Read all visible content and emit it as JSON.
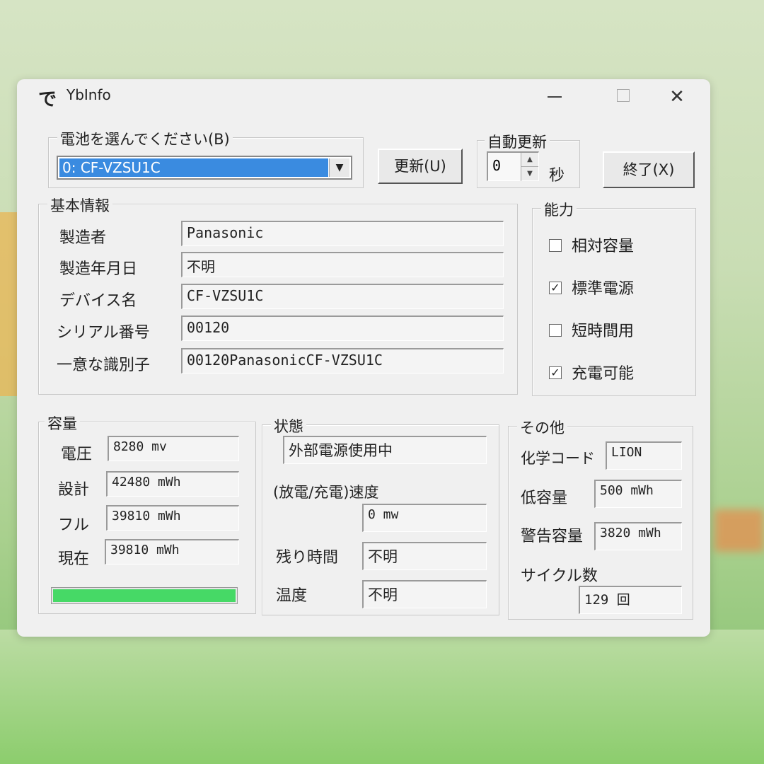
{
  "window": {
    "title": "YbInfo",
    "icon_glyph": "で",
    "close_glyph": "✕"
  },
  "battery_select": {
    "legend": "電池を選んでください(B)",
    "selected": "0: CF-VZSU1C",
    "arrow": "▼"
  },
  "refresh_button": "更新(U)",
  "auto_update": {
    "legend": "自動更新",
    "value": "0",
    "unit": "秒",
    "up": "▲",
    "down": "▼"
  },
  "exit_button": "終了(X)",
  "basic_info": {
    "legend": "基本情報",
    "rows": [
      {
        "label": "製造者",
        "value": "Panasonic"
      },
      {
        "label": "製造年月日",
        "value": "不明"
      },
      {
        "label": "デバイス名",
        "value": "CF-VZSU1C"
      },
      {
        "label": "シリアル番号",
        "value": "00120"
      },
      {
        "label": "一意な識別子",
        "value": "00120PanasonicCF-VZSU1C"
      }
    ]
  },
  "capability": {
    "legend": "能力",
    "items": [
      {
        "label": "相対容量",
        "checked": false,
        "mark": ""
      },
      {
        "label": "標準電源",
        "checked": true,
        "mark": "✓"
      },
      {
        "label": "短時間用",
        "checked": false,
        "mark": ""
      },
      {
        "label": "充電可能",
        "checked": true,
        "mark": "✓"
      }
    ]
  },
  "capacity": {
    "legend": "容量",
    "rows": [
      {
        "label": "電圧",
        "value": "8280 mv"
      },
      {
        "label": "設計",
        "value": "42480 mWh"
      },
      {
        "label": "フル",
        "value": "39810 mWh"
      },
      {
        "label": "現在",
        "value": "39810 mWh"
      }
    ],
    "charge_fraction": 1.0,
    "bar_color": "#46d966"
  },
  "status": {
    "legend": "状態",
    "state": "外部電源使用中",
    "rate_label": "(放電/充電)速度",
    "rate_value": "0 mw",
    "remaining_label": "残り時間",
    "remaining_value": "不明",
    "temp_label": "温度",
    "temp_value": "不明"
  },
  "other": {
    "legend": "その他",
    "chem_label": "化学コード",
    "chem_value": "LION",
    "low_label": "低容量",
    "low_value": "500 mWh",
    "warn_label": "警告容量",
    "warn_value": "3820 mWh",
    "cycle_label": "サイクル数",
    "cycle_value": "129 回"
  }
}
